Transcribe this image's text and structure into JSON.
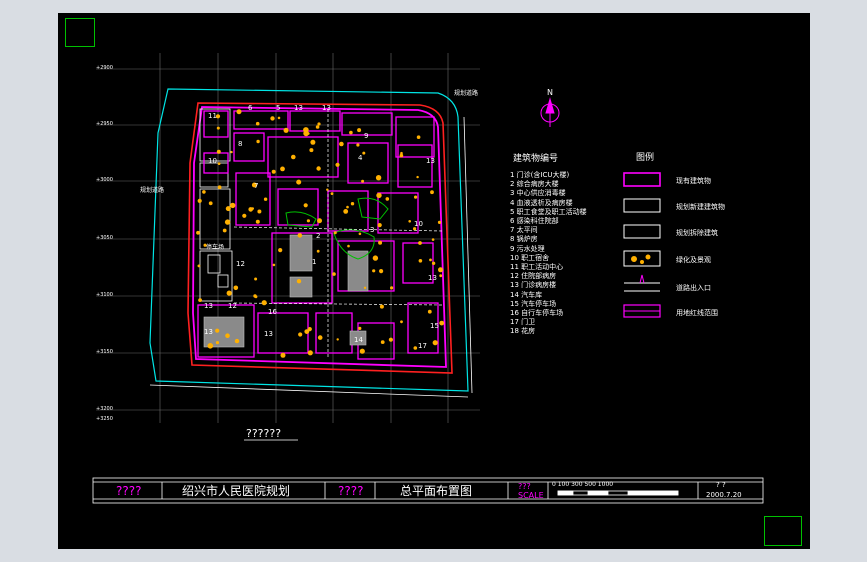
{
  "drawing": {
    "caption": "??????",
    "north_label": "N",
    "building_list_title": "建筑物编号",
    "building_list": [
      "1 门诊(含ICU大楼)",
      "2 综合病房大楼",
      "3 中心供应消毒楼",
      "4 血液透析及病房楼",
      "5 职工食堂及职工活动楼",
      "6 感染科住院部",
      "7 太平间",
      "8 锅炉房",
      "9 污水处理",
      "10 职工宿舍",
      "11 职工活动中心",
      "12 住院部病房",
      "13 门诊病房楼",
      "14 汽车库",
      "15 汽车停车场",
      "16 自行车停车场",
      "17 门卫",
      "18 花房"
    ],
    "legend_title": "图例",
    "legend_items": [
      "现有建筑物",
      "规划新建建筑物",
      "规划拆除建筑",
      "绿化及景观",
      "道路出入口",
      "用地红线范围"
    ],
    "site_labels": {
      "left_road": "规划道路",
      "right_road": "规划道路",
      "inner_label": "停车场"
    },
    "block_numbers": [
      "11",
      "6",
      "5",
      "13",
      "13",
      "9",
      "10",
      "8",
      "13",
      "7",
      "10",
      "12",
      "4",
      "3",
      "2",
      "1",
      "13",
      "16",
      "13",
      "12",
      "13",
      "13",
      "14",
      "15",
      "17"
    ],
    "grid_left_labels": [
      "+2900",
      "+2950",
      "+3000",
      "+3050",
      "+3100",
      "+3150",
      "+3200",
      "+3250"
    ]
  },
  "title_block": {
    "field1": "????",
    "project": "绍兴市人民医院规划",
    "field2": "????",
    "drawing_name": "总平面布置图",
    "scale_label": "???",
    "scale_sub": "SCALE",
    "scale_ticks": "0  100   300   500              1000",
    "sheet_no": "?   ?",
    "date": "2000.7.20"
  },
  "colors": {
    "background": "#000000",
    "canvas_frame": "#d9dde3",
    "site_boundary": "#ff00ff",
    "red_line": "#ff2020",
    "cyan_line": "#00e5e5",
    "green_frame": "#00c000",
    "tree": "#ffb000"
  }
}
